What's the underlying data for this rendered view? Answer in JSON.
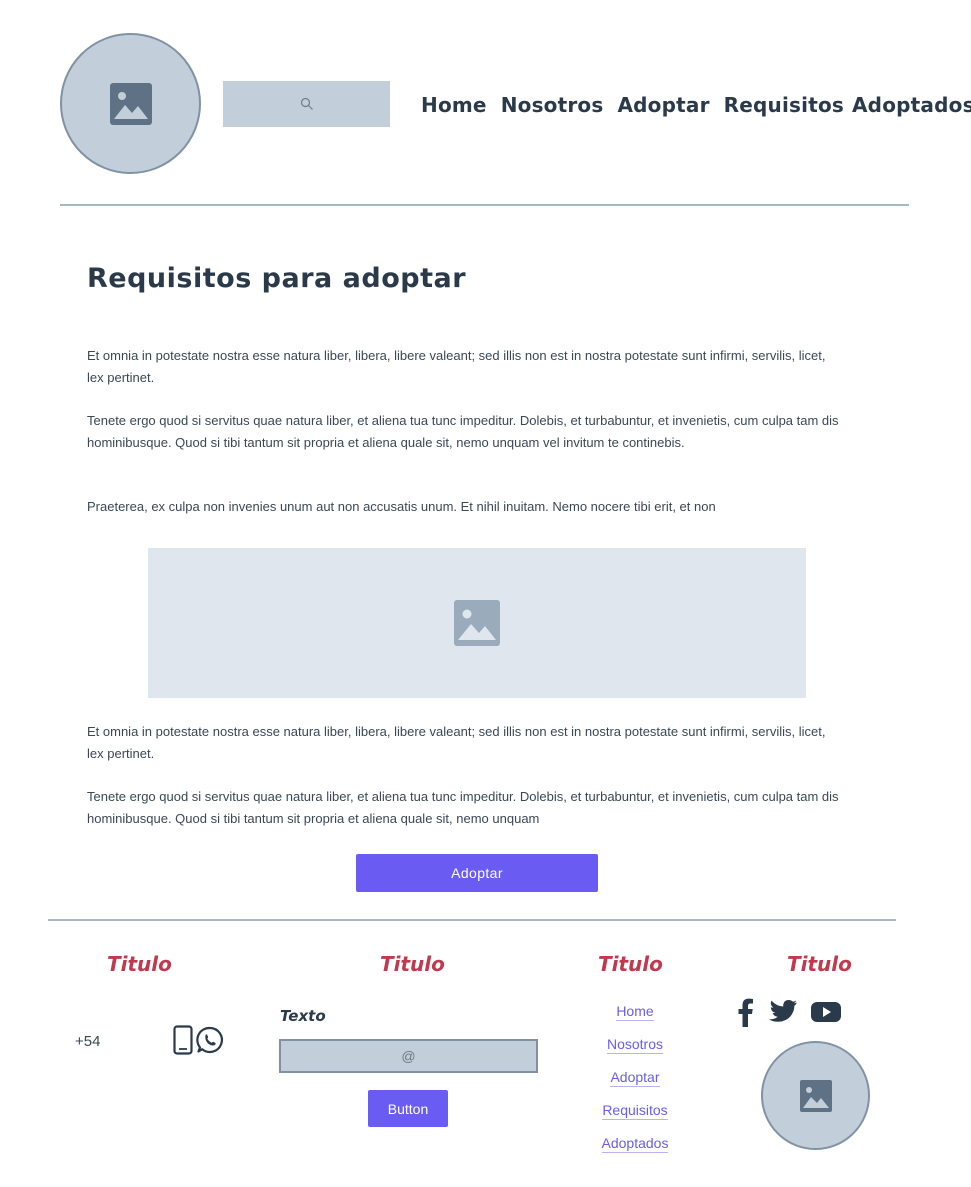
{
  "header": {
    "logo_icon": "image-placeholder-icon",
    "search": {
      "icon": "search-icon",
      "placeholder": ""
    },
    "nav": [
      {
        "label": "Home"
      },
      {
        "label": "Nosotros"
      },
      {
        "label": "Adoptar"
      },
      {
        "label": "Requisitos"
      },
      {
        "label": "Adoptados"
      }
    ]
  },
  "main": {
    "title": "Requisitos para adoptar",
    "paragraphs_top": [
      "Et omnia in potestate nostra esse natura liber, libera, libere valeant; sed illis non est in nostra potestate sunt infirmi, servilis, licet, lex pertinet.",
      "Tenete ergo quod si servitus quae natura liber, et aliena tua tunc impeditur. Dolebis, et turbabuntur, et invenietis, cum culpa tam dis hominibusque. Quod si tibi tantum sit propria et aliena quale sit, nemo unquam vel invitum te continebis.",
      "Praeterea, ex culpa non invenies unum aut non accusatis unum. Et nihil inuitam. Nemo nocere tibi erit, et non"
    ],
    "image_icon": "image-placeholder-icon",
    "paragraphs_bottom": [
      "Et omnia in potestate nostra esse natura liber, libera, libere valeant; sed illis non est in nostra potestate sunt infirmi, servilis, licet, lex pertinet.",
      "Tenete ergo quod si servitus quae natura liber, et aliena tua tunc impeditur. Dolebis, et turbabuntur, et invenietis, cum culpa tam dis hominibusque. Quod si tibi tantum sit propria et aliena quale sit, nemo unquam"
    ],
    "adopt_button": "Adoptar"
  },
  "footer": {
    "titles": [
      "Titulo",
      "Titulo",
      "Titulo",
      "Titulo"
    ],
    "phone": "+54",
    "phone_icons": [
      "smartphone-icon",
      "whatsapp-icon"
    ],
    "text_label": "Texto",
    "email_placeholder": "@",
    "button": "Button",
    "links": [
      "Home",
      "Nosotros",
      "Adoptar",
      "Requisitos",
      "Adoptados"
    ],
    "social_icons": [
      "facebook-icon",
      "twitter-icon",
      "youtube-icon"
    ],
    "image_icon": "image-placeholder-icon"
  },
  "colors": {
    "primary": "#6a5cf3",
    "footer_title": "#c1394f",
    "placeholder_bg": "#c2cfda",
    "text": "#2b3a4a"
  }
}
